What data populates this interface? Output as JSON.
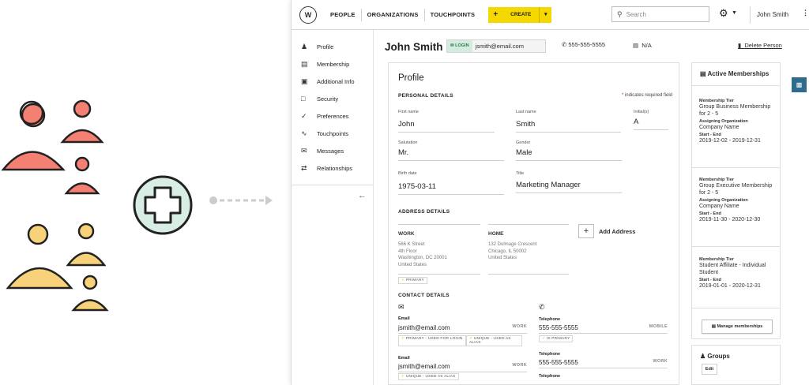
{
  "topbar": {
    "logo": "W",
    "tabs": [
      "PEOPLE",
      "ORGANIZATIONS",
      "TOUCHPOINTS"
    ],
    "create_label": "CREATE",
    "create_plus": "+",
    "search_placeholder": "Search",
    "user_name": "John Smith",
    "brand_color": "#f5d800"
  },
  "sidebar": {
    "items": [
      {
        "label": "Profile",
        "icon": "person-icon"
      },
      {
        "label": "Membership",
        "icon": "monitor-icon"
      },
      {
        "label": "Additional Info",
        "icon": "id-card-icon"
      },
      {
        "label": "Security",
        "icon": "lock-icon"
      },
      {
        "label": "Preferences",
        "icon": "check-icon"
      },
      {
        "label": "Touchpoints",
        "icon": "trend-icon"
      },
      {
        "label": "Messages",
        "icon": "mail-icon"
      },
      {
        "label": "Relationships",
        "icon": "relationship-icon"
      }
    ]
  },
  "header": {
    "name": "John Smith",
    "login_tag": "LOGIN",
    "email": "jsmith@email.com",
    "phone": "555-555-5555",
    "device": "N/A",
    "delete": "Delete Person"
  },
  "profile": {
    "title": "Profile",
    "personal_details": "PERSONAL DETAILS",
    "required_note": "indicates required field",
    "first_name_label": "First name",
    "first_name": "John",
    "last_name_label": "Last name",
    "last_name": "Smith",
    "initials_label": "Initial(s)",
    "initials": "A",
    "salutation_label": "Salutation",
    "salutation": "Mr.",
    "gender_label": "Gender",
    "gender": "Male",
    "birth_label": "Birth date",
    "birth": "1975-03-11",
    "title_label": "Title",
    "title_value": "Marketing Manager"
  },
  "address": {
    "heading": "ADDRESS DETAILS",
    "add_label": "Add Address",
    "work": {
      "label": "WORK",
      "lines": [
        "566 K Street",
        "4th Floor",
        "Washington, DC 20001",
        "United States"
      ],
      "tag": "PRIMARY"
    },
    "home": {
      "label": "HOME",
      "lines": [
        "132 Dulmage Crescent",
        "Chicago, IL 50002",
        "United States"
      ]
    }
  },
  "contact": {
    "heading": "CONTACT DETAILS",
    "email_label": "Email",
    "email1": "jsmith@email.com",
    "email1_kind": "WORK",
    "email1_tags": [
      "PRIMARY - USED FOR LOGIN",
      "UNIQUE - USED AS ALIAS"
    ],
    "email2": "jsmith@email.com",
    "email2_kind": "WORK",
    "email2_tag": "UNIQUE - USED AS ALIAS",
    "tel_label": "Telephone",
    "tel1": "555-555-5555",
    "tel1_kind": "MOBILE",
    "tel1_tag": "IS PRIMARY",
    "tel2": "555-555-5555",
    "tel2_kind": "WORK",
    "tel3_label": "Telephone"
  },
  "memberships": {
    "title": "Active Memberships",
    "tier_label": "Membership Tier",
    "org_label": "Assigning Organization",
    "dates_label": "Start - End",
    "items": [
      {
        "tier": "Group Business Membership for 2 - 5",
        "org": "Company Name",
        "dates": "2019-12-02 - 2019-12-31"
      },
      {
        "tier": "Group Executive Membership for 2 - 5",
        "org": "Company Name",
        "dates": "2019-11-30 - 2020-12-30"
      },
      {
        "tier": "Student Affiliate - Individual Student",
        "dates": "2019-01-01 - 2020-12-31"
      }
    ],
    "manage": "Manage memberships"
  },
  "groups": {
    "title": "Groups",
    "edit": "Edit"
  }
}
